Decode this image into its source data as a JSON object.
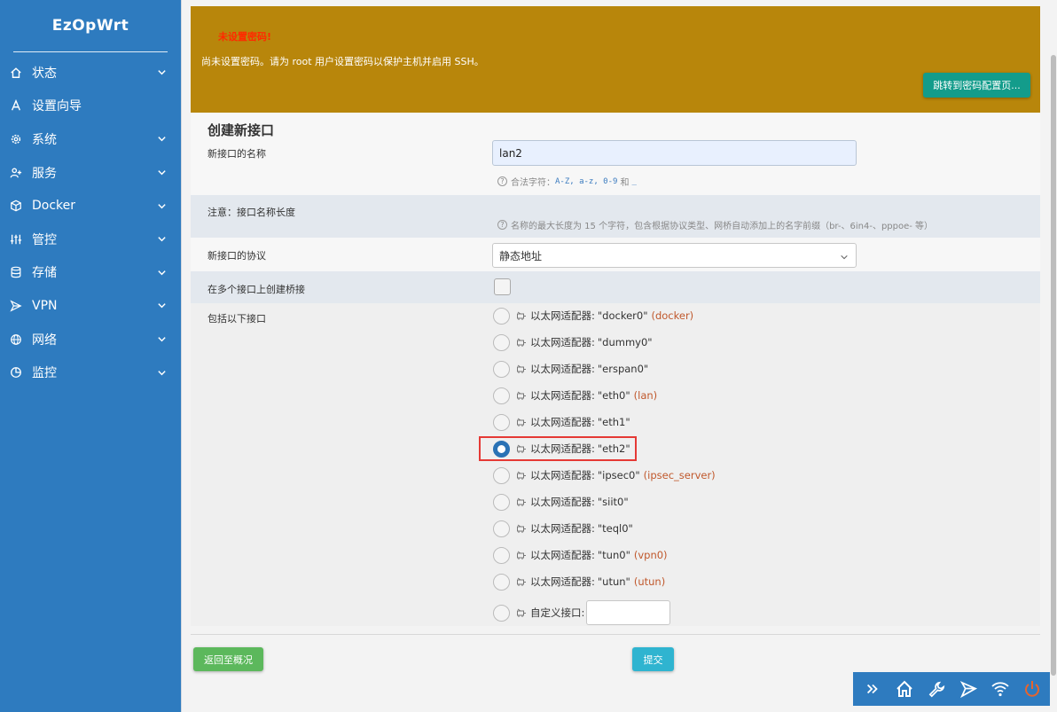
{
  "sidebar": {
    "brand": "EzOpWrt",
    "items": [
      {
        "label": "状态",
        "icon": "home-icon",
        "has_children": true
      },
      {
        "label": "设置向导",
        "icon": "wizard-icon",
        "has_children": false
      },
      {
        "label": "系统",
        "icon": "gear-icon",
        "has_children": true
      },
      {
        "label": "服务",
        "icon": "user-plus-icon",
        "has_children": true
      },
      {
        "label": "Docker",
        "icon": "cube-icon",
        "has_children": true
      },
      {
        "label": "管控",
        "icon": "sliders-icon",
        "has_children": true
      },
      {
        "label": "存储",
        "icon": "database-icon",
        "has_children": true
      },
      {
        "label": "VPN",
        "icon": "send-icon",
        "has_children": true
      },
      {
        "label": "网络",
        "icon": "globe-icon",
        "has_children": true
      },
      {
        "label": "监控",
        "icon": "pie-chart-icon",
        "has_children": true
      }
    ]
  },
  "alert": {
    "title": "未设置密码!",
    "message": "尚未设置密码。请为 root 用户设置密码以保护主机并启用 SSH。",
    "button": "跳转到密码配置页..."
  },
  "form": {
    "title": "创建新接口",
    "name_label": "新接口的名称",
    "name_value": "lan2",
    "name_help_prefix": "合法字符：",
    "name_help_chars": "A-Z, a-z, 0-9",
    "name_help_and": "和",
    "name_help_underscore": "_",
    "note_label": "注意：接口名称长度",
    "note_help": "名称的最大长度为 15 个字符，包含根据协议类型、网桥自动添加上的名字前缀（br-、6in4-、pppoe- 等）",
    "protocol_label": "新接口的协议",
    "protocol_value": "静态地址",
    "bridge_label": "在多个接口上创建桥接",
    "include_label": "包括以下接口",
    "interfaces": [
      {
        "prefix": "以太网适配器:",
        "name": "\"docker0\"",
        "zone": "(docker)",
        "checked": false
      },
      {
        "prefix": "以太网适配器:",
        "name": "\"dummy0\"",
        "zone": "",
        "checked": false
      },
      {
        "prefix": "以太网适配器:",
        "name": "\"erspan0\"",
        "zone": "",
        "checked": false
      },
      {
        "prefix": "以太网适配器:",
        "name": "\"eth0\"",
        "zone": "(lan)",
        "checked": false
      },
      {
        "prefix": "以太网适配器:",
        "name": "\"eth1\"",
        "zone": "",
        "checked": false
      },
      {
        "prefix": "以太网适配器:",
        "name": "\"eth2\"",
        "zone": "",
        "checked": true
      },
      {
        "prefix": "以太网适配器:",
        "name": "\"ipsec0\"",
        "zone": "(ipsec_server)",
        "checked": false
      },
      {
        "prefix": "以太网适配器:",
        "name": "\"siit0\"",
        "zone": "",
        "checked": false
      },
      {
        "prefix": "以太网适配器:",
        "name": "\"teql0\"",
        "zone": "",
        "checked": false
      },
      {
        "prefix": "以太网适配器:",
        "name": "\"tun0\"",
        "zone": "(vpn0)",
        "checked": false
      },
      {
        "prefix": "以太网适配器:",
        "name": "\"utun\"",
        "zone": "(utun)",
        "checked": false
      }
    ],
    "custom_label": "自定义接口:"
  },
  "footer": {
    "back_button": "返回至概况",
    "submit_button": "提交"
  },
  "dock": {
    "icons": [
      "double-chevron-right-icon",
      "home-icon",
      "wrench-icon",
      "send-icon",
      "wifi-icon",
      "power-icon"
    ]
  },
  "colors": {
    "sidebar": "#2e7bbf",
    "alert": "#b8860b",
    "alert_title": "#ff2a00",
    "alert_button": "#139c8b",
    "back_button": "#5cb85c",
    "submit_button": "#2fb4d0",
    "zone_text": "#c0582c",
    "highlight_box": "#e53935"
  }
}
